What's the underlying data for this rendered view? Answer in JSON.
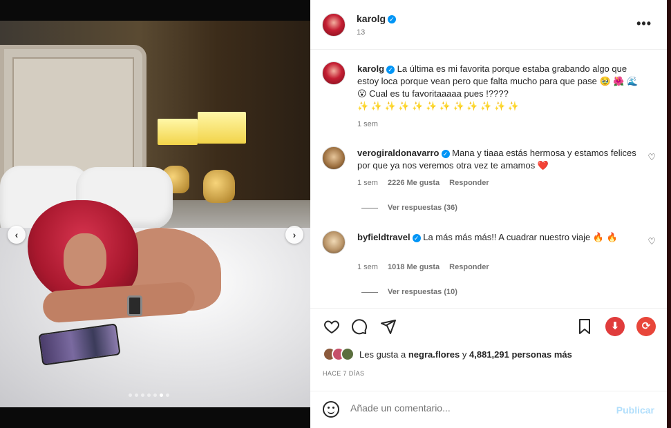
{
  "post": {
    "author": "karolg",
    "header_sub": "13",
    "caption_text": "La última es mi favorita porque estaba grabando algo que estoy loca porque vean pero que falta mucho para que pase 🥹 🌺 🌊 😮 Cual es tu favoritaaaaa pues !????",
    "caption_sparkles": "✨ ✨ ✨ ✨ ✨ ✨ ✨ ✨ ✨ ✨ ✨ ✨",
    "caption_time": "1 sem"
  },
  "comments": [
    {
      "user": "verogiraldonavarro",
      "text": "Mana y tiaaa estás hermosa y estamos felices por que ya nos veremos otra vez te amamos ❤️",
      "time": "1 sem",
      "likes": "2226 Me gusta",
      "reply": "Responder",
      "view_replies": "Ver respuestas (36)"
    },
    {
      "user": "byfieldtravel",
      "text": "La más más más!! A cuadrar nuestro viaje 🔥 🔥",
      "time": "1 sem",
      "likes": "1018 Me gusta",
      "reply": "Responder",
      "view_replies": "Ver respuestas (10)"
    }
  ],
  "likes_line": {
    "prefix": "Les gusta a",
    "user": "negra.flores",
    "middle": "y",
    "count": "4,881,291 personas más"
  },
  "posted_ago": "HACE 7 DÍAS",
  "add_comment": {
    "placeholder": "Añade un comentario...",
    "publish": "Publicar"
  },
  "carousel": {
    "slides": 7,
    "active_index": 5
  },
  "icons": {
    "like": "heart-icon",
    "comment": "comment-icon",
    "share": "paper-plane-icon",
    "save": "bookmark-icon",
    "download": "download-icon",
    "refresh": "refresh-icon"
  },
  "colors": {
    "verified": "#0095f6",
    "download": "#e03c3c",
    "refresh": "#e8463a",
    "publish": "#b2dffc"
  }
}
